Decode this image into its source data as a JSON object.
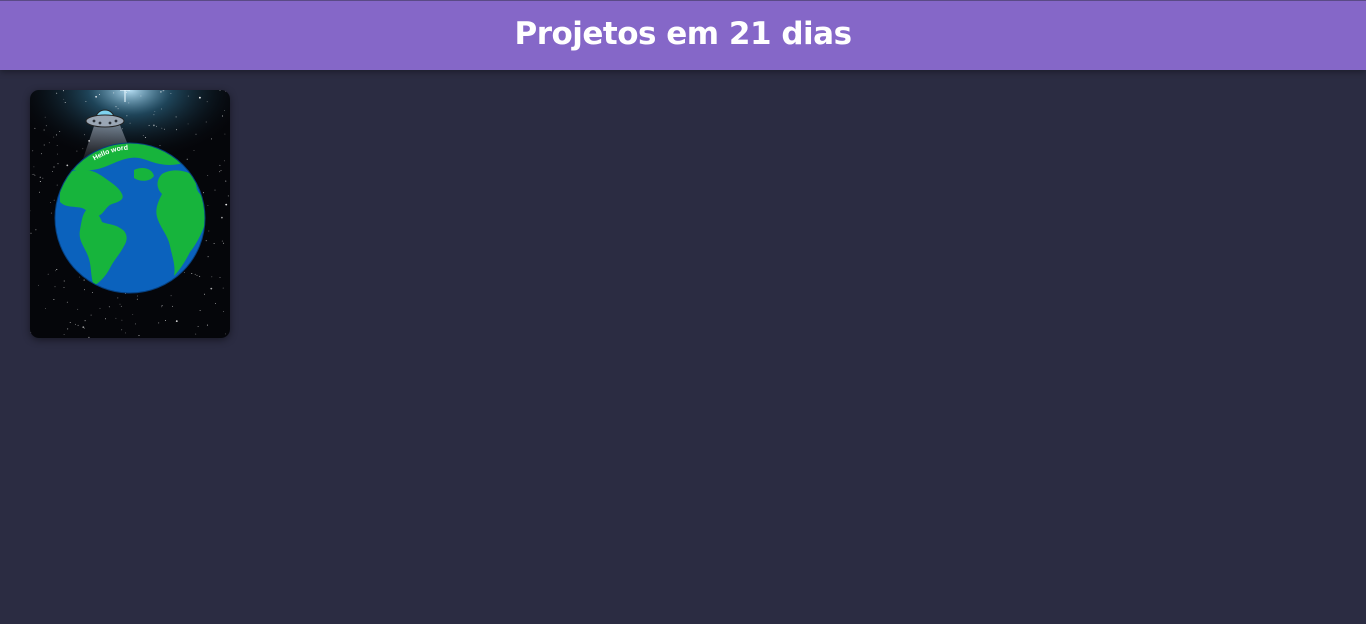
{
  "header": {
    "title": "Projetos em 21 dias"
  },
  "projects": [
    {
      "thumbnail_caption": "Hello word"
    }
  ],
  "colors": {
    "header_bg": "#8567c8",
    "page_bg": "#2b2c42",
    "ocean": "#0b62bd",
    "land": "#17b43c",
    "space": "#05060a"
  }
}
